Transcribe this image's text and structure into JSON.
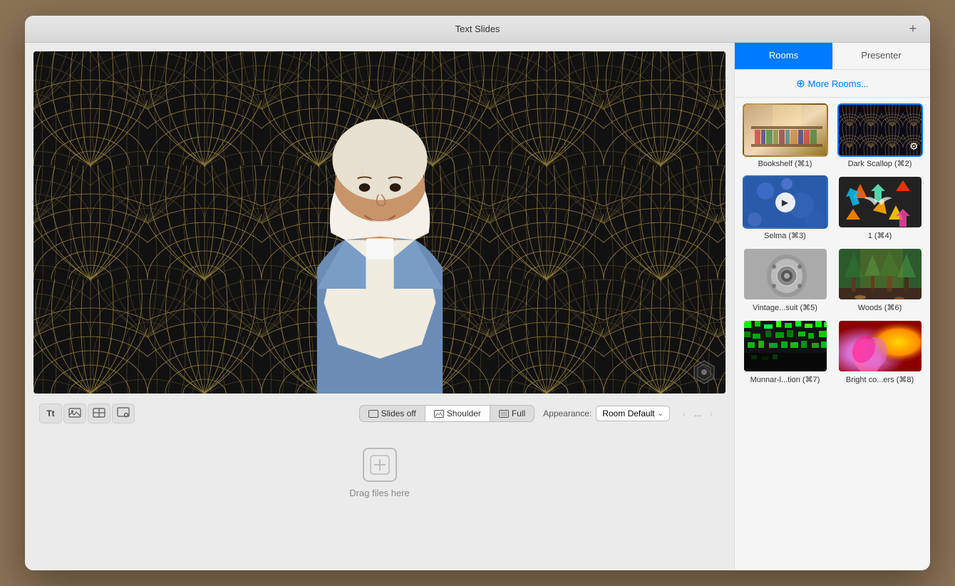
{
  "window": {
    "title": "Text Slides",
    "add_button": "+"
  },
  "tabs": {
    "rooms": "Rooms",
    "presenter": "Presenter"
  },
  "sidebar": {
    "more_rooms": "More Rooms...",
    "rooms": [
      {
        "id": "bookshelf",
        "label": "Bookshelf (⌘1)",
        "selected": false,
        "theme": "bookshelf"
      },
      {
        "id": "dark-scallop",
        "label": "Dark Scallop (⌘2)",
        "selected": true,
        "theme": "darkscallop"
      },
      {
        "id": "selma",
        "label": "Selma (⌘3)",
        "selected": false,
        "theme": "selma",
        "has_play": true
      },
      {
        "id": "1",
        "label": "1 (⌘4)",
        "selected": false,
        "theme": "1"
      },
      {
        "id": "vintage-suit",
        "label": "Vintage...suit (⌘5)",
        "selected": false,
        "theme": "vintage"
      },
      {
        "id": "woods",
        "label": "Woods (⌘6)",
        "selected": false,
        "theme": "woods"
      },
      {
        "id": "munnar",
        "label": "Munnar-l...tion (⌘7)",
        "selected": false,
        "theme": "munnar"
      },
      {
        "id": "bright",
        "label": "Bright co...ers (⌘8)",
        "selected": false,
        "theme": "bright"
      }
    ]
  },
  "toolbar": {
    "text_icon": "Tt",
    "image_icon": "🖼",
    "layout_icon": "⊞",
    "settings_icon": "⚙",
    "view_buttons": [
      {
        "id": "slides-off",
        "label": "Slides off",
        "active": false
      },
      {
        "id": "shoulder",
        "label": "Shoulder",
        "active": true
      },
      {
        "id": "full",
        "label": "Full",
        "active": false
      }
    ],
    "appearance_label": "Appearance:",
    "appearance_value": "Room Default",
    "nav_dots": "..."
  },
  "drop_zone": {
    "text": "Drag files here"
  },
  "preview": {
    "has_watermark": true,
    "watermark_icon": "⬡"
  }
}
